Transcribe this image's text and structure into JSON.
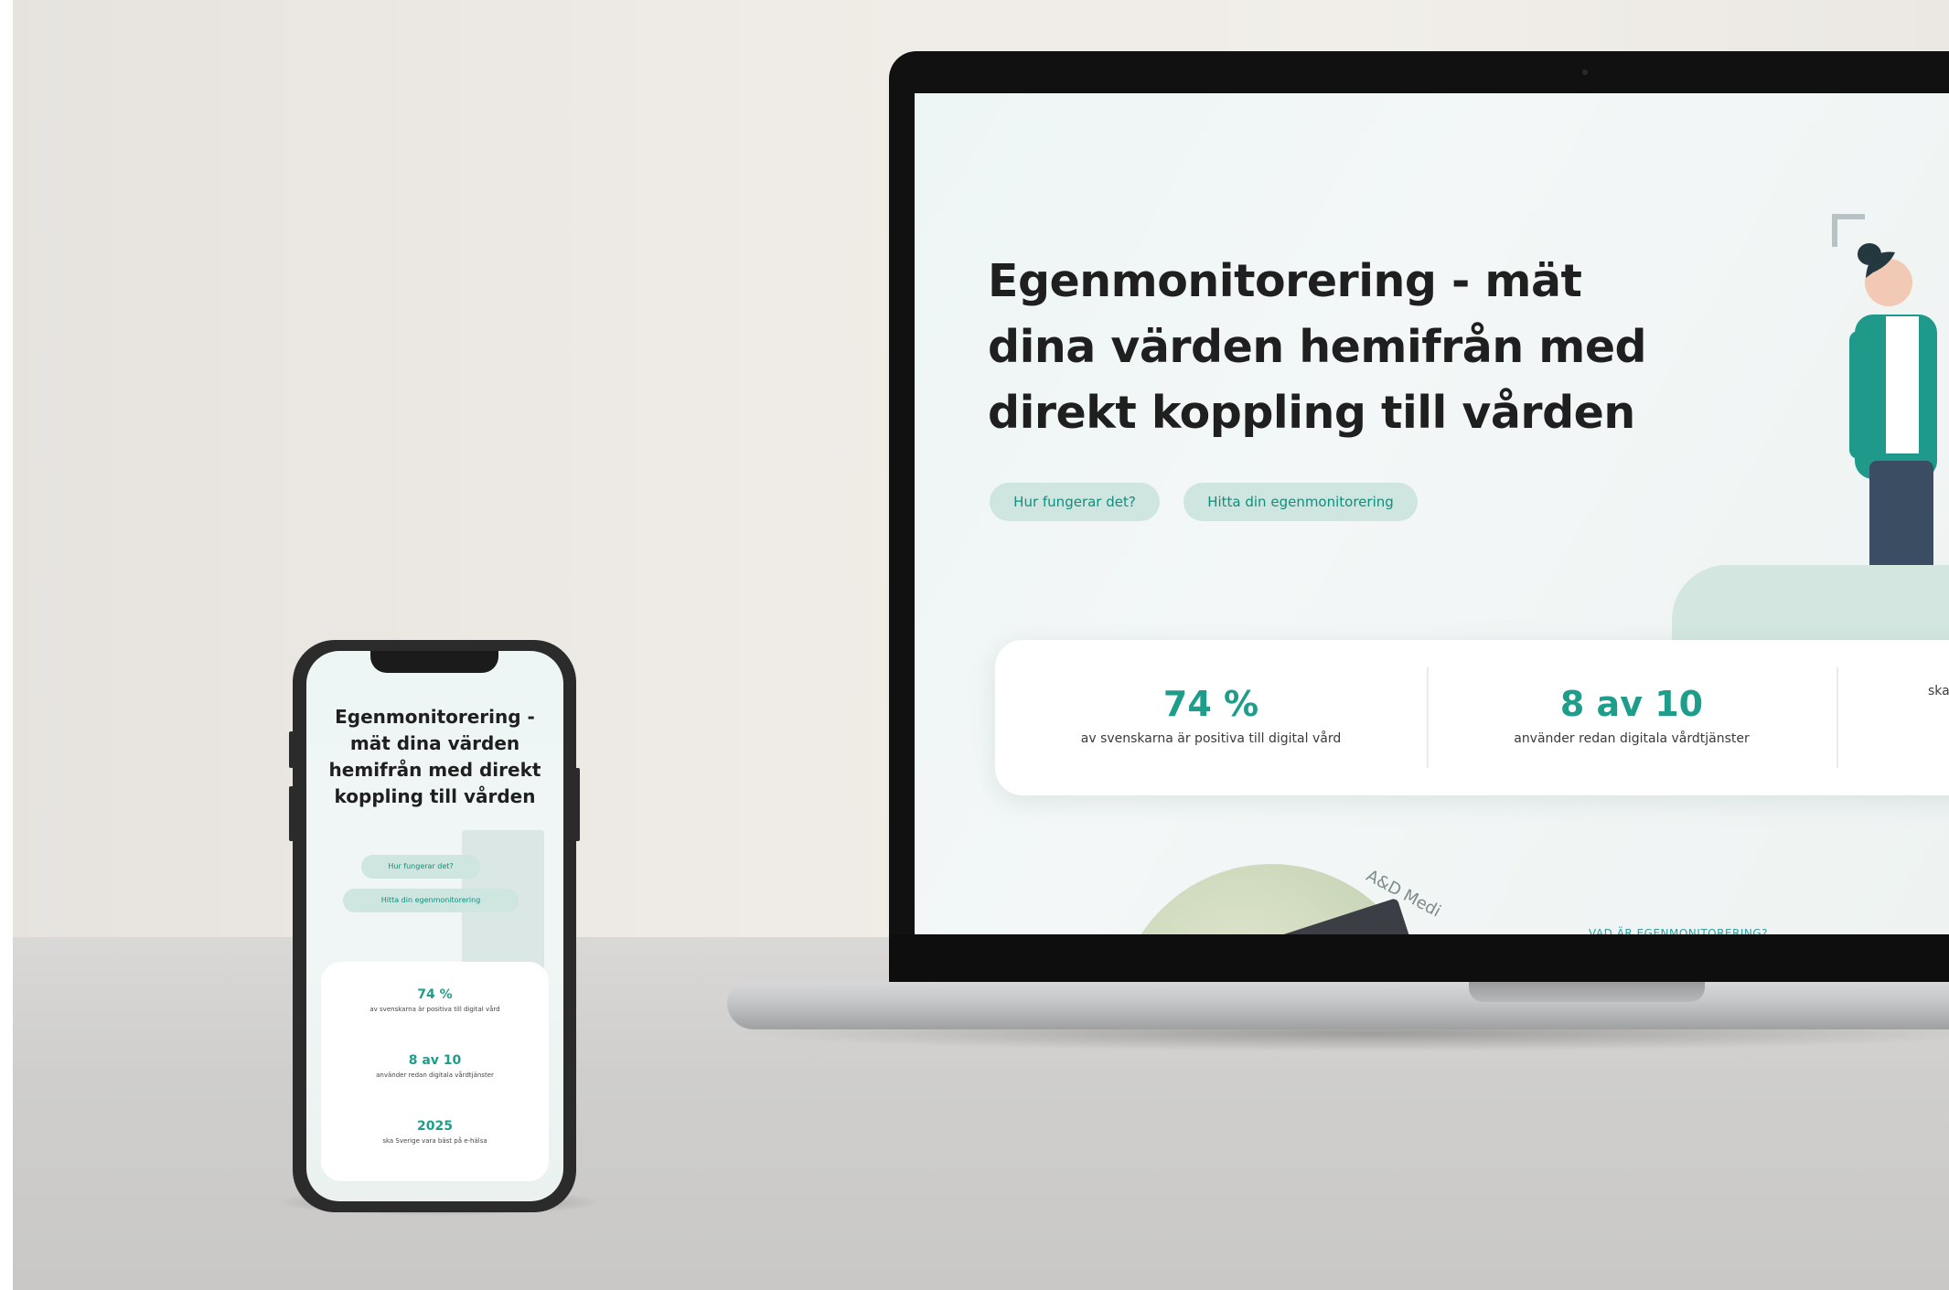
{
  "laptop": {
    "hero_title": "Egenmonitorering - mät dina värden hemifrån med direkt koppling till vården",
    "buttons": {
      "how_it_works": "Hur fungerar det?",
      "find_monitoring": "Hitta din egenmonitorering"
    },
    "stats": [
      {
        "value": "74 %",
        "label": "av svenskarna är positiva till digital vård"
      },
      {
        "value": "8 av 10",
        "label": "använder redan digitala vårdtjänster"
      },
      {
        "value": "",
        "label": "ska"
      }
    ],
    "section_kicker": "VAD ÄR EGENMONITORERING?",
    "photo_brand": "A&D Medi"
  },
  "phone": {
    "hero_title": "Egenmonitorering - mät dina värden hemifrån med direkt koppling till vården",
    "buttons": {
      "how_it_works": "Hur fungerar det?",
      "find_monitoring": "Hitta din egenmonitorering"
    },
    "stats": [
      {
        "value": "74 %",
        "label": "av svenskarna är positiva till digital vård"
      },
      {
        "value": "8 av 10",
        "label": "använder redan digitala vårdtjänster"
      },
      {
        "value": "2025",
        "label": "ska Sverige vara bäst på e-hälsa"
      }
    ]
  },
  "colors": {
    "accent": "#1e9d8b",
    "pill_bg": "#cfe5df",
    "pill_text": "#0f8f7d"
  }
}
